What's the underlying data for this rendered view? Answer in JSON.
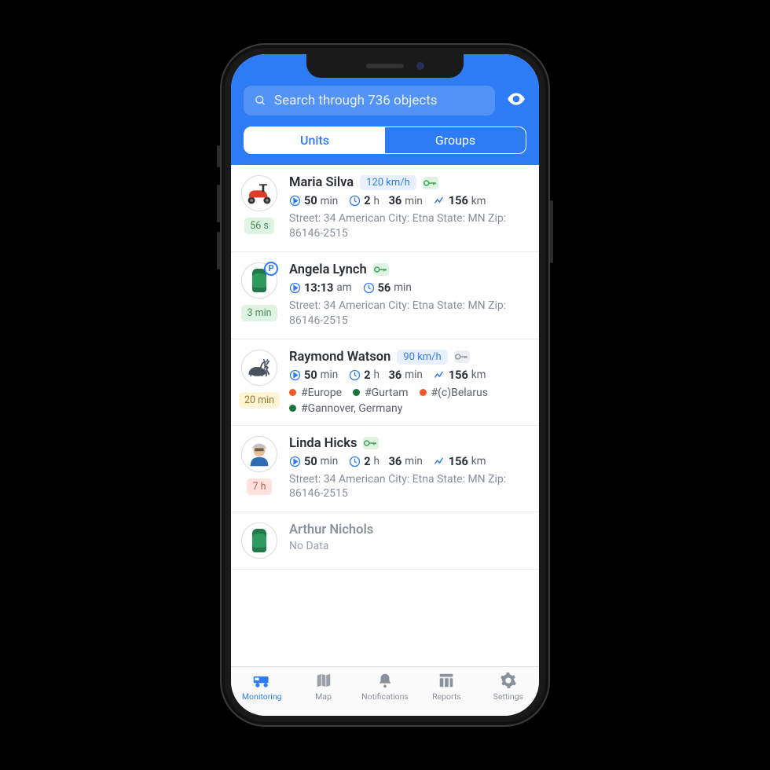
{
  "search": {
    "placeholder": "Search through 736 objects"
  },
  "segmented": {
    "units": "Units",
    "groups": "Groups"
  },
  "units": [
    {
      "name": "Maria Silva",
      "speed": "120 km/h",
      "key": "on",
      "time_badge": "56 s",
      "badge_class": "b-green",
      "trip": {
        "v": "50",
        "u": "min"
      },
      "duration": {
        "v1": "2",
        "u1": "h",
        "v2": "36",
        "u2": "min"
      },
      "distance": {
        "v": "156",
        "u": "km"
      },
      "address": "Street: 34 American City: Etna State: MN Zip: 86146-2515",
      "avatar_type": "scooter"
    },
    {
      "name": "Angela Lynch",
      "key": "on",
      "time_badge": "3 min",
      "badge_class": "b-green",
      "park_time": {
        "v": "13:13",
        "u": "am"
      },
      "park_dur": {
        "v": "56",
        "u": "min"
      },
      "address": "Street: 34 American City: Etna State: MN Zip: 86146-2515",
      "avatar_type": "car-parked"
    },
    {
      "name": "Raymond Watson",
      "speed": "90 km/h",
      "key": "off",
      "time_badge": "20 min",
      "badge_class": "b-yellow",
      "trip": {
        "v": "50",
        "u": "min"
      },
      "duration": {
        "v1": "2",
        "u1": "h",
        "v2": "36",
        "u2": "min"
      },
      "distance": {
        "v": "156",
        "u": "km"
      },
      "tags": [
        {
          "label": "#Europe",
          "color": "#f05a28"
        },
        {
          "label": "#Gurtam",
          "color": "#16753a"
        },
        {
          "label": "#(c)Belarus",
          "color": "#f05a28"
        },
        {
          "label": "#Gannover, Germany",
          "color": "#16753a"
        }
      ],
      "avatar_type": "cat"
    },
    {
      "name": "Linda Hicks",
      "key": "on",
      "time_badge": "7 h",
      "badge_class": "b-red",
      "trip": {
        "v": "50",
        "u": "min"
      },
      "duration": {
        "v1": "2",
        "u1": "h",
        "v2": "36",
        "u2": "min"
      },
      "distance": {
        "v": "156",
        "u": "km"
      },
      "address": "Street: 34 American City: Etna State: MN Zip: 86146-2515",
      "avatar_type": "person"
    },
    {
      "name": "Arthur Nichols",
      "nodata": "No Data",
      "avatar_type": "car"
    }
  ],
  "tabs": {
    "monitoring": "Monitoring",
    "map": "Map",
    "notifications": "Notifications",
    "reports": "Reports",
    "settings": "Settings"
  }
}
